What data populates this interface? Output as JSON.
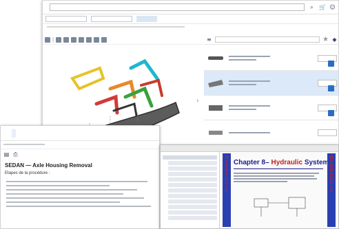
{
  "catalog": {
    "brand": "",
    "search": {
      "placeholder": ""
    },
    "nav_field": "",
    "toolbar_title": "",
    "parts": [
      {
        "qty": "",
        "selected": false
      },
      {
        "qty": "",
        "selected": true
      },
      {
        "qty": "",
        "selected": false
      },
      {
        "qty": "",
        "selected": false
      }
    ]
  },
  "manual": {
    "tabs": [
      "",
      "",
      ""
    ],
    "title": "SEDAN — Axle Housing Removal",
    "steps_heading": "Etapes de la procédure :"
  },
  "pdf": {
    "chapter_prefix": "Chapter 8–",
    "chapter_word": "Hydraulic",
    "chapter_suffix": "System",
    "side_letters": "HYDRAULIC"
  },
  "colors": {
    "brand": "#2e8b3a",
    "selected_row": "#dce9f9",
    "pdf_strip": "#2a3fb0",
    "pdf_red": "#c01d1d",
    "add_button": "#2a6ec2"
  }
}
